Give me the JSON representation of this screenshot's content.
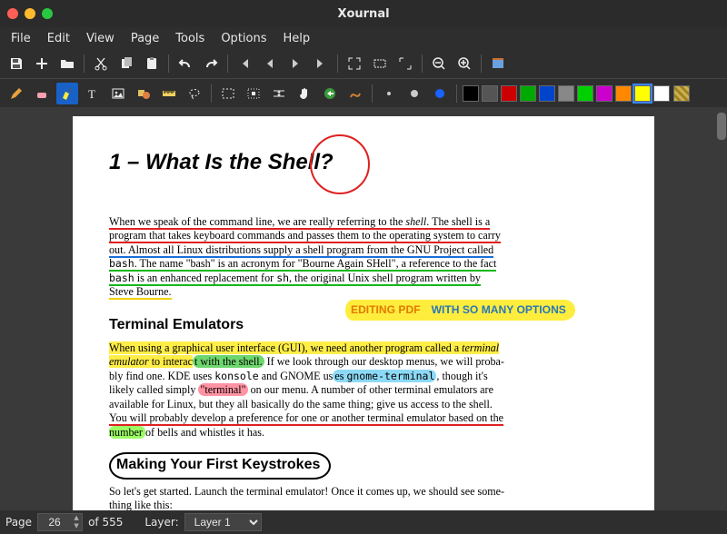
{
  "app": {
    "title": "Xournal"
  },
  "menu": {
    "file": "File",
    "edit": "Edit",
    "view": "View",
    "page": "Page",
    "tools": "Tools",
    "options": "Options",
    "help": "Help"
  },
  "status": {
    "page_label": "Page",
    "page_current": "26",
    "page_total": "of 555",
    "layer_label": "Layer:",
    "layer_value": "Layer 1"
  },
  "colors": {
    "palette": [
      "#000000",
      "#555555",
      "#cc0000",
      "#00aa00",
      "#0044cc",
      "#888888",
      "#00d000",
      "#cc00cc",
      "#ff8800",
      "#ffff00",
      "#ffffff"
    ],
    "selected_index": 9
  },
  "doc": {
    "h1": "1 – What Is the Shell?",
    "para1": {
      "s1a": "When we speak of the command line, we are really referring to the ",
      "s1b_italic": "shell",
      "s1c": ". The shell is a ",
      "s2": "program that takes keyboard commands and passes them to the operating system to carry ",
      "s3": "out. Almost all Linux distributions supply a shell program from the GNU Project called ",
      "s4a_mono": "bash",
      "s4b": ". The name \"bash\" is an acronym for \"Bourne Again SHell\", a reference to the fact ",
      "s5a_mono": "bash",
      "s5b": " is an enhanced replacement for ",
      "s5c_mono": "sh",
      "s5d": ", the original Unix shell program written by ",
      "s6": "Steve Bourne."
    },
    "banner_left": "EDITING PDF",
    "banner_right": "WITH SO MANY OPTIONS",
    "h2a": "Terminal Emulators",
    "para2": {
      "t1a": "When using a graphical user interface (GUI), we need another program called a ",
      "t1b_italic": "terminal ",
      "t2a_italic": "emulator",
      "t2b": " to interac",
      "t2c_hl": "t with the shell.",
      "t2d": " If we look through our desktop menus, we will proba-",
      "t3a": "bly find one. KDE uses ",
      "t3b_mono": "konsole",
      "t3c": " and GNOME us",
      "t3d_hl": "es ",
      "t3e_mono": "gnome-terminal",
      "t3f": ", though it's ",
      "t4a": "likely called simply ",
      "t4b_hl": "\"terminal\"",
      "t4c": " on our menu. A number of other terminal emulators are ",
      "t5": "available for Linux, but they all basically do the same thing; give us access to the shell. ",
      "t6": "You will probably develop a preference for one or another terminal emulator based on the ",
      "t7a_hl": "number ",
      "t7b": "of bells and whistles it has."
    },
    "h2b": "Making Your First Keystrokes",
    "para3a": "So let's get started. Launch the terminal emulator! Once it comes up, we should see some-",
    "para3b": "thing like this:"
  }
}
